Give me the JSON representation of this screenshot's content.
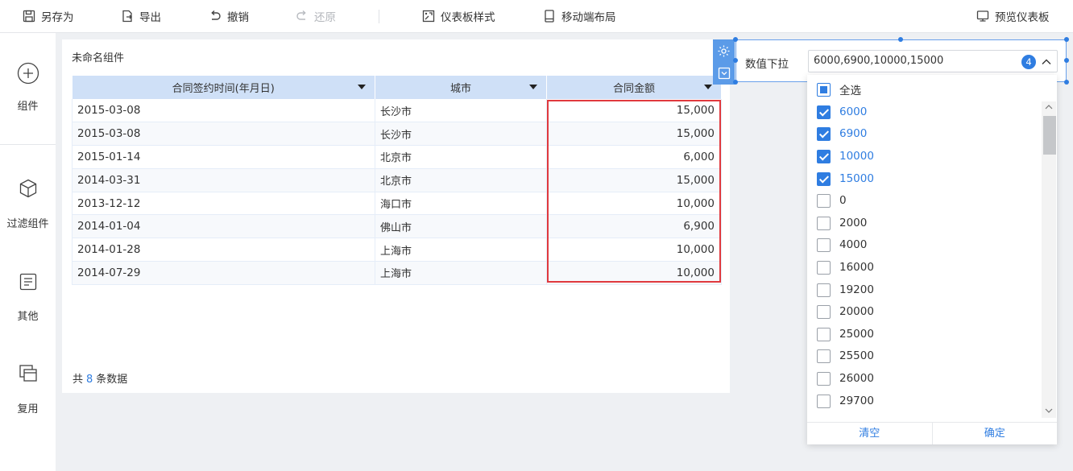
{
  "toolbar": {
    "save_as": "另存为",
    "export": "导出",
    "undo": "撤销",
    "redo": "还原",
    "dashboard_style": "仪表板样式",
    "mobile_layout": "移动端布局",
    "preview": "预览仪表板"
  },
  "rail": {
    "items": [
      {
        "label": "组件",
        "icon": "plus-circle-icon"
      },
      {
        "label": "过滤组件",
        "icon": "cube-icon"
      },
      {
        "label": "其他",
        "icon": "note-icon"
      },
      {
        "label": "复用",
        "icon": "copy-icon"
      }
    ]
  },
  "widget": {
    "title": "未命名组件",
    "columns": [
      "合同签约时间(年月日)",
      "城市",
      "合同金额"
    ],
    "rows": [
      [
        "2015-03-08",
        "长沙市",
        "15,000"
      ],
      [
        "2015-03-08",
        "长沙市",
        "15,000"
      ],
      [
        "2015-01-14",
        "北京市",
        "6,000"
      ],
      [
        "2014-03-31",
        "北京市",
        "15,000"
      ],
      [
        "2013-12-12",
        "海口市",
        "10,000"
      ],
      [
        "2014-01-04",
        "佛山市",
        "6,900"
      ],
      [
        "2014-01-28",
        "上海市",
        "10,000"
      ],
      [
        "2014-07-29",
        "上海市",
        "10,000"
      ]
    ],
    "footer_prefix": "共",
    "footer_count": "8",
    "footer_suffix": "条数据"
  },
  "filter": {
    "label": "数值下拉",
    "value": "6000,6900,10000,15000",
    "selected_count": "4",
    "select_all": "全选",
    "options": [
      {
        "label": "6000",
        "checked": true
      },
      {
        "label": "6900",
        "checked": true
      },
      {
        "label": "10000",
        "checked": true
      },
      {
        "label": "15000",
        "checked": true
      },
      {
        "label": "0",
        "checked": false
      },
      {
        "label": "2000",
        "checked": false
      },
      {
        "label": "4000",
        "checked": false
      },
      {
        "label": "16000",
        "checked": false
      },
      {
        "label": "19200",
        "checked": false
      },
      {
        "label": "20000",
        "checked": false
      },
      {
        "label": "25000",
        "checked": false
      },
      {
        "label": "25500",
        "checked": false
      },
      {
        "label": "26000",
        "checked": false
      },
      {
        "label": "29700",
        "checked": false
      }
    ],
    "clear_label": "清空",
    "confirm_label": "确定"
  },
  "colors": {
    "accent": "#2f7de1",
    "header_bg": "#cfe0f7",
    "highlight_border": "#e0393e"
  }
}
